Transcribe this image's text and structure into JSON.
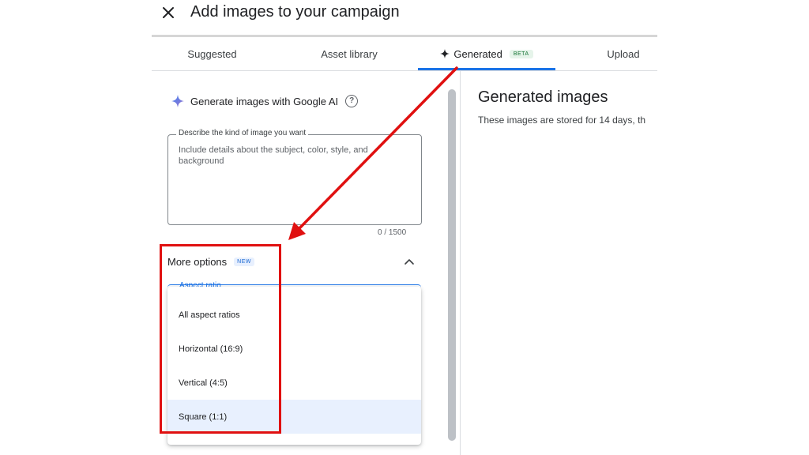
{
  "header": {
    "close_icon": "close-icon",
    "title": "Add images to your campaign"
  },
  "tabs": [
    {
      "label": "Suggested",
      "active": false
    },
    {
      "label": "Asset library",
      "active": false
    },
    {
      "label": "Generated",
      "active": true,
      "badge": "BETA",
      "icon": "sparkle-icon"
    },
    {
      "label": "Upload",
      "active": false
    }
  ],
  "generator": {
    "title": "Generate images with Google AI",
    "icon": "google-ai-sparkle-icon",
    "help_icon": "help-icon",
    "prompt_label": "Describe the kind of image you want",
    "prompt_placeholder": "Include details about the subject, color, style, and background",
    "prompt_value": "",
    "counter": "0 / 1500",
    "more_options_label": "More options",
    "more_options_badge": "NEW",
    "aspect_ratio_label": "Aspect ratio",
    "aspect_options": [
      {
        "label": "All aspect ratios",
        "selected": false
      },
      {
        "label": "Horizontal (16:9)",
        "selected": false
      },
      {
        "label": "Vertical (4:5)",
        "selected": false
      },
      {
        "label": "Square (1:1)",
        "selected": true
      }
    ]
  },
  "results": {
    "title": "Generated images",
    "subtitle": "These images are stored for 14 days, th"
  },
  "colors": {
    "accent": "#1a73e8",
    "annotation": "#e01010",
    "selected_bg": "#e8f0fe"
  }
}
